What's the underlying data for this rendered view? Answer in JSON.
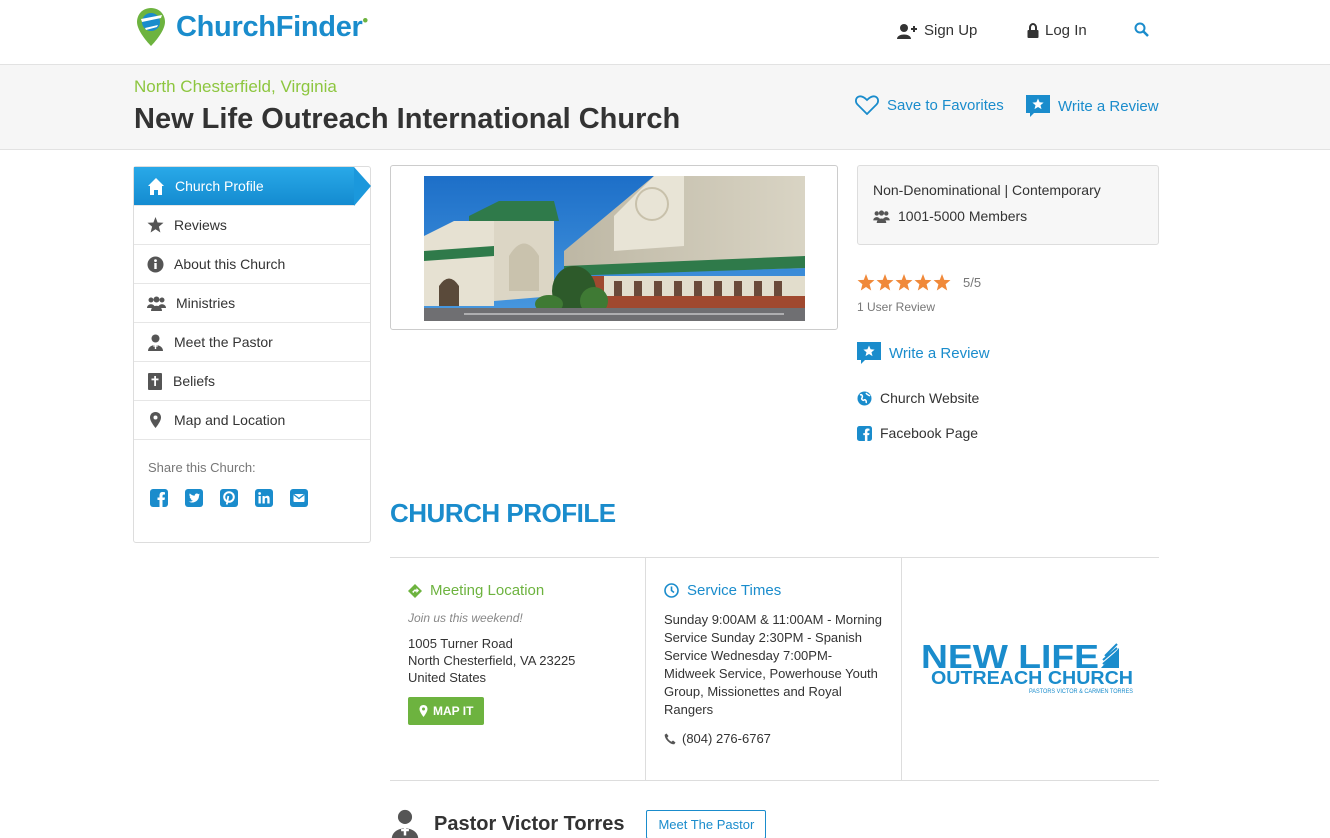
{
  "header": {
    "logo_text": "ChurchFinder",
    "signup": "Sign Up",
    "login": "Log In"
  },
  "title": {
    "location": "North Chesterfield, Virginia",
    "church_name": "New Life Outreach International Church",
    "save_favorites": "Save to Favorites",
    "write_review": "Write a Review"
  },
  "sidebar": {
    "items": [
      {
        "label": "Church Profile",
        "icon": "church-icon",
        "active": true
      },
      {
        "label": "Reviews",
        "icon": "star-icon"
      },
      {
        "label": "About this Church",
        "icon": "info-icon"
      },
      {
        "label": "Ministries",
        "icon": "group-icon"
      },
      {
        "label": "Meet the Pastor",
        "icon": "pastor-icon"
      },
      {
        "label": "Beliefs",
        "icon": "bible-icon"
      },
      {
        "label": "Map and Location",
        "icon": "map-marker-icon"
      }
    ],
    "share_label": "Share this Church:",
    "share_icons": [
      "facebook-icon",
      "twitter-icon",
      "pinterest-icon",
      "linkedin-icon",
      "email-icon"
    ]
  },
  "info": {
    "denomination": "Non-Denominational | Contemporary",
    "members": "1001-5000 Members",
    "rating_score": "5/5",
    "rating_stars": 5,
    "review_count": "1 User Review",
    "write_review": "Write a Review",
    "website": "Church Website",
    "facebook": "Facebook Page"
  },
  "profile": {
    "heading": "CHURCH PROFILE",
    "meeting_title": "Meeting Location",
    "join_text": "Join us this weekend!",
    "address_line1": "1005 Turner Road",
    "address_line2": "North Chesterfield, VA 23225",
    "address_line3": "United States",
    "map_button": "MAP IT",
    "service_title": "Service Times",
    "service_times": "Sunday 9:00AM & 11:00AM - Morning Service Sunday 2:30PM - Spanish Service Wednesday 7:00PM- Midweek Service, Powerhouse Youth Group, Missionettes and Royal Rangers",
    "phone": "(804) 276-6767",
    "logo_line1": "NEW LIFE",
    "logo_line2": "OUTREACH CHURCH",
    "logo_line3": "PASTORS VICTOR & CARMEN TORRES"
  },
  "pastor": {
    "name": "Pastor Victor Torres",
    "button": "Meet The Pastor"
  },
  "colors": {
    "brand_blue": "#1a8ccc",
    "brand_green": "#6db33f",
    "star_orange": "#f0893a"
  }
}
